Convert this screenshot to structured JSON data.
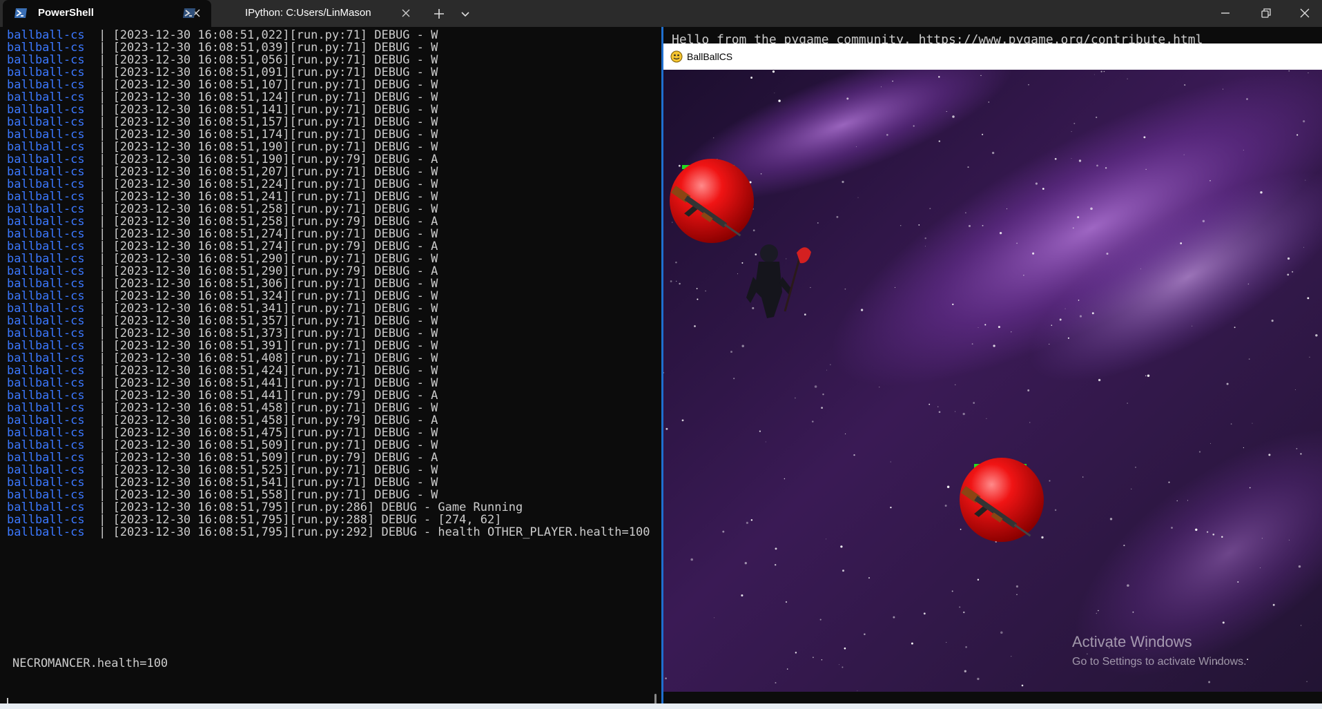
{
  "tabs": [
    {
      "label": "PowerShell",
      "active": true
    },
    {
      "label": "IPython: C:Users/LinMason",
      "active": false
    }
  ],
  "terminal": {
    "service": "ballball-cs",
    "separator": "|",
    "lines": [
      "[2023-12-30 16:08:51,022][run.py:71] DEBUG - W",
      "[2023-12-30 16:08:51,039][run.py:71] DEBUG - W",
      "[2023-12-30 16:08:51,056][run.py:71] DEBUG - W",
      "[2023-12-30 16:08:51,091][run.py:71] DEBUG - W",
      "[2023-12-30 16:08:51,107][run.py:71] DEBUG - W",
      "[2023-12-30 16:08:51,124][run.py:71] DEBUG - W",
      "[2023-12-30 16:08:51,141][run.py:71] DEBUG - W",
      "[2023-12-30 16:08:51,157][run.py:71] DEBUG - W",
      "[2023-12-30 16:08:51,174][run.py:71] DEBUG - W",
      "[2023-12-30 16:08:51,190][run.py:71] DEBUG - W",
      "[2023-12-30 16:08:51,190][run.py:79] DEBUG - A",
      "[2023-12-30 16:08:51,207][run.py:71] DEBUG - W",
      "[2023-12-30 16:08:51,224][run.py:71] DEBUG - W",
      "[2023-12-30 16:08:51,241][run.py:71] DEBUG - W",
      "[2023-12-30 16:08:51,258][run.py:71] DEBUG - W",
      "[2023-12-30 16:08:51,258][run.py:79] DEBUG - A",
      "[2023-12-30 16:08:51,274][run.py:71] DEBUG - W",
      "[2023-12-30 16:08:51,274][run.py:79] DEBUG - A",
      "[2023-12-30 16:08:51,290][run.py:71] DEBUG - W",
      "[2023-12-30 16:08:51,290][run.py:79] DEBUG - A",
      "[2023-12-30 16:08:51,306][run.py:71] DEBUG - W",
      "[2023-12-30 16:08:51,324][run.py:71] DEBUG - W",
      "[2023-12-30 16:08:51,341][run.py:71] DEBUG - W",
      "[2023-12-30 16:08:51,357][run.py:71] DEBUG - W",
      "[2023-12-30 16:08:51,373][run.py:71] DEBUG - W",
      "[2023-12-30 16:08:51,391][run.py:71] DEBUG - W",
      "[2023-12-30 16:08:51,408][run.py:71] DEBUG - W",
      "[2023-12-30 16:08:51,424][run.py:71] DEBUG - W",
      "[2023-12-30 16:08:51,441][run.py:71] DEBUG - W",
      "[2023-12-30 16:08:51,441][run.py:79] DEBUG - A",
      "[2023-12-30 16:08:51,458][run.py:71] DEBUG - W",
      "[2023-12-30 16:08:51,458][run.py:79] DEBUG - A",
      "[2023-12-30 16:08:51,475][run.py:71] DEBUG - W",
      "[2023-12-30 16:08:51,509][run.py:71] DEBUG - W",
      "[2023-12-30 16:08:51,509][run.py:79] DEBUG - A",
      "[2023-12-30 16:08:51,525][run.py:71] DEBUG - W",
      "[2023-12-30 16:08:51,541][run.py:71] DEBUG - W",
      "[2023-12-30 16:08:51,558][run.py:71] DEBUG - W",
      "[2023-12-30 16:08:51,795][run.py:286] DEBUG - Game Running",
      "[2023-12-30 16:08:51,795][run.py:288] DEBUG - [274, 62]",
      "[2023-12-30 16:08:51,795][run.py:292] DEBUG - health OTHER_PLAYER.health=100"
    ],
    "wrapped_line": "NECROMANCER.health=100"
  },
  "right_terminal": {
    "text": "Hello from the pygame community. https://www.pygame.org/contribute.html"
  },
  "game": {
    "window_title": "BallBallCS",
    "balls": [
      {
        "health": 100,
        "color": "#e01010",
        "weapon": "ak47-rifle"
      },
      {
        "health": 100,
        "color": "#e01010",
        "weapon": "ak47-rifle"
      }
    ],
    "health_bar_color": "#22dd22",
    "character": "necromancer",
    "background": "purple-nebula-space"
  },
  "watermark": {
    "title": "Activate Windows",
    "subtitle": "Go to Settings to activate Windows."
  },
  "colors": {
    "service_name": "#3b78ff",
    "terminal_text": "#cccccc",
    "terminal_bg": "#0c0c0c",
    "pane_divider": "#1f6fce"
  }
}
